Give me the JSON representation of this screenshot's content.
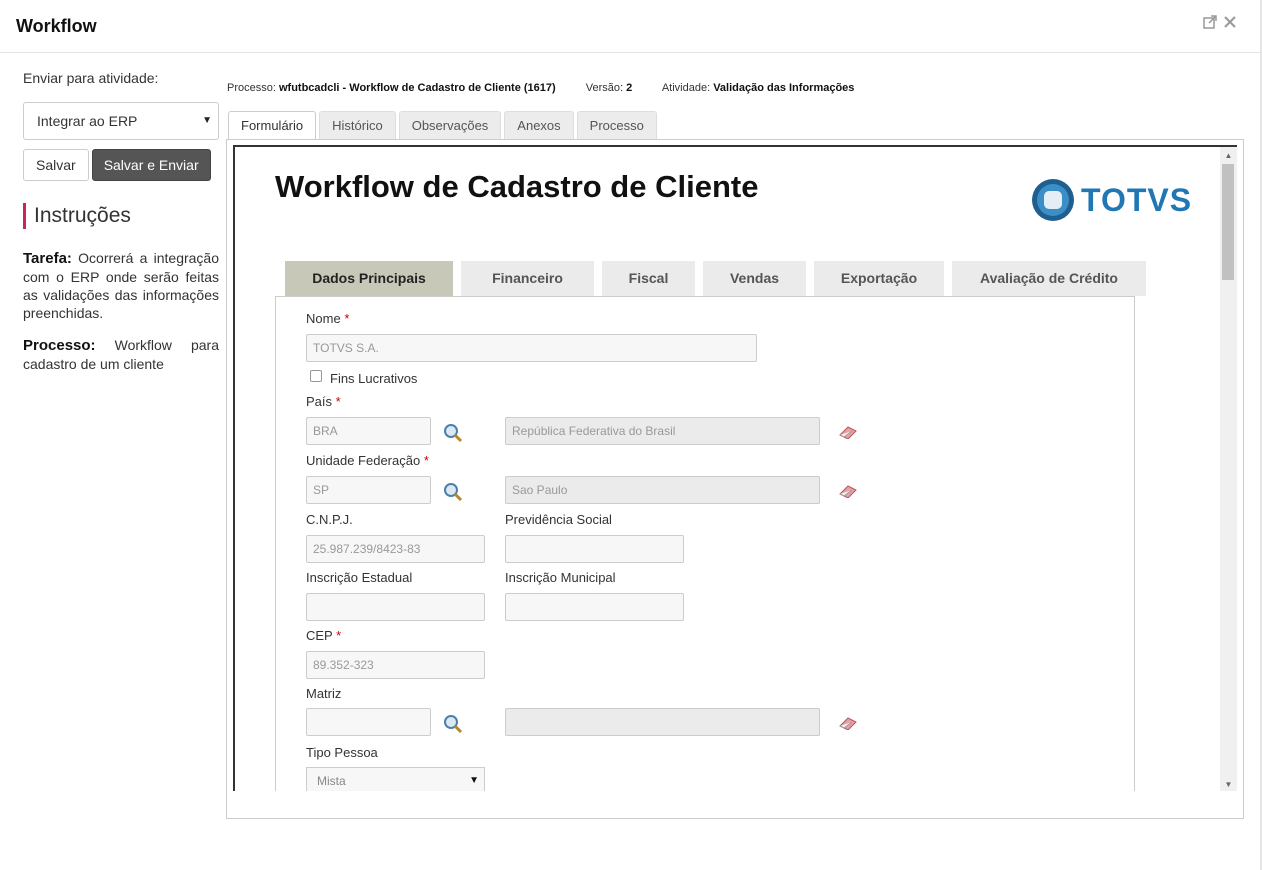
{
  "window": {
    "title": "Workflow"
  },
  "sidebar": {
    "send_label": "Enviar para atividade:",
    "activity_selected": "Integrar ao ERP",
    "save_label": "Salvar",
    "save_send_label": "Salvar e Enviar",
    "instructions_title": "Instruções",
    "task_label": "Tarefa:",
    "task_text": "Ocorrerá a integração com o ERP onde serão feitas as validações das informações preenchidas.",
    "process_label": "Processo:",
    "process_text": "Workflow para cadastro de um cliente"
  },
  "process_info": {
    "process_label": "Processo:",
    "process_value": "wfutbcadcli - Workflow de Cadastro de Cliente (1617)",
    "version_label": "Versão:",
    "version_value": "2",
    "activity_label": "Atividade:",
    "activity_value": "Validação das Informações"
  },
  "outer_tabs": [
    "Formulário",
    "Histórico",
    "Observações",
    "Anexos",
    "Processo"
  ],
  "form": {
    "title": "Workflow de Cadastro de Cliente",
    "logo_text": "TOTVS",
    "tabs": [
      "Dados Principais",
      "Financeiro",
      "Fiscal",
      "Vendas",
      "Exportação",
      "Avaliação de Crédito"
    ],
    "nome_label": "Nome",
    "nome_value": "TOTVS S.A.",
    "fins_label": "Fins Lucrativos",
    "pais_label": "País",
    "pais_code": "BRA",
    "pais_name": "República Federativa do Brasil",
    "uf_label": "Unidade Federação",
    "uf_code": "SP",
    "uf_name": "Sao Paulo",
    "cnpj_label": "C.N.P.J.",
    "cnpj_value": "25.987.239/8423-83",
    "prev_label": "Previdência Social",
    "ie_label": "Inscrição Estadual",
    "im_label": "Inscrição Municipal",
    "cep_label": "CEP",
    "cep_value": "89.352-323",
    "matriz_label": "Matriz",
    "tipo_label": "Tipo Pessoa",
    "tipo_value": "Mista",
    "required_mark": "*"
  },
  "colors": {
    "accent": "#c7255f",
    "active_tab": "#c8c8b8",
    "logo": "#1f78b4"
  }
}
